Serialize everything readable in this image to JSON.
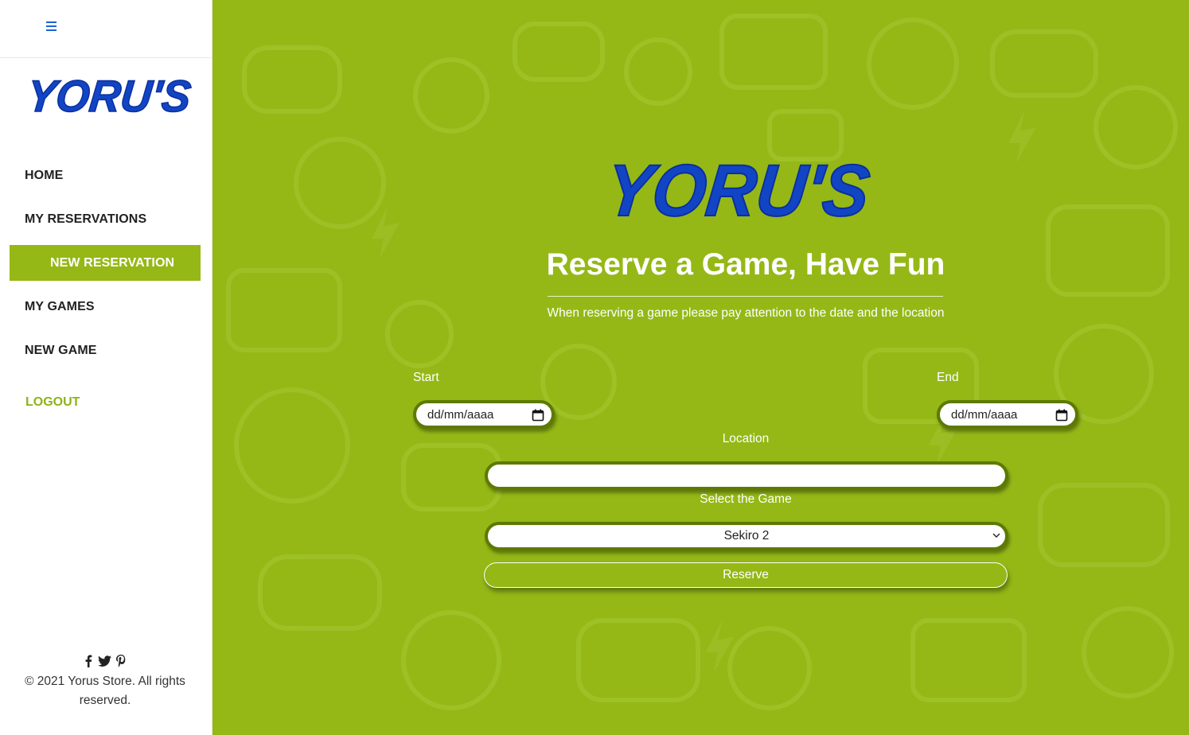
{
  "sidebar": {
    "brand": "YORU'S",
    "items": [
      {
        "label": "HOME"
      },
      {
        "label": "MY RESERVATIONS"
      },
      {
        "label": "NEW RESERVATION"
      },
      {
        "label": "MY GAMES"
      },
      {
        "label": "NEW GAME"
      }
    ],
    "logout_label": "LOGOUT",
    "social_icons": [
      "facebook-icon",
      "twitter-icon",
      "pinterest-icon"
    ],
    "copyright": "© 2021 Yorus Store. All rights reserved."
  },
  "hero": {
    "brand": "YORU'S",
    "title": "Reserve a Game, Have Fun",
    "subtitle": "When reserving a game please pay attention to the date and the location"
  },
  "form": {
    "start_label": "Start",
    "start_placeholder": "dd/mm/aaaa",
    "end_label": "End",
    "end_placeholder": "dd/mm/aaaa",
    "location_label": "Location",
    "location_value": "",
    "game_label": "Select the Game",
    "game_selected": "Sekiro 2",
    "submit_label": "Reserve"
  },
  "colors": {
    "accent_green": "#95b816",
    "input_border": "#5d7a00",
    "logo_blue": "#1245c4",
    "logout_green": "#8db317"
  }
}
